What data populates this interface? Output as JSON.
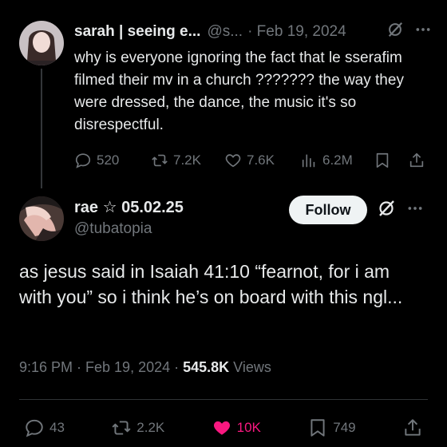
{
  "tweet1": {
    "name": "sarah | seeing e...",
    "handle": "@s...",
    "date": "· Feb 19, 2024",
    "text": "why is everyone ignoring the fact that le sserafim filmed their mv in a church ??????? the way they were dressed, the dance, the music it's so disrespectful.",
    "replies": "520",
    "retweets": "7.2K",
    "likes": "7.6K",
    "views": "6.2M"
  },
  "tweet2": {
    "name": "rae ☆ 05.02.25",
    "handle": "@tubatopia",
    "follow_label": "Follow",
    "text": "as jesus said in Isaiah 41:10 “fearnot, for i am with you” so i think he’s on board with this ngl...",
    "time": "9:16 PM · Feb 19, 2024 ·",
    "views_count": "545.8K",
    "views_label": "Views",
    "replies": "43",
    "retweets": "2.2K",
    "likes": "10K",
    "bookmarks": "749"
  },
  "colors": {
    "background": "#000000",
    "text_primary": "#e7e9ea",
    "text_secondary": "#71767b",
    "like_active": "#f91880"
  },
  "icons": [
    "grok-icon",
    "more-icon",
    "reply-icon",
    "retweet-icon",
    "like-icon",
    "views-icon",
    "bookmark-icon",
    "share-icon"
  ]
}
